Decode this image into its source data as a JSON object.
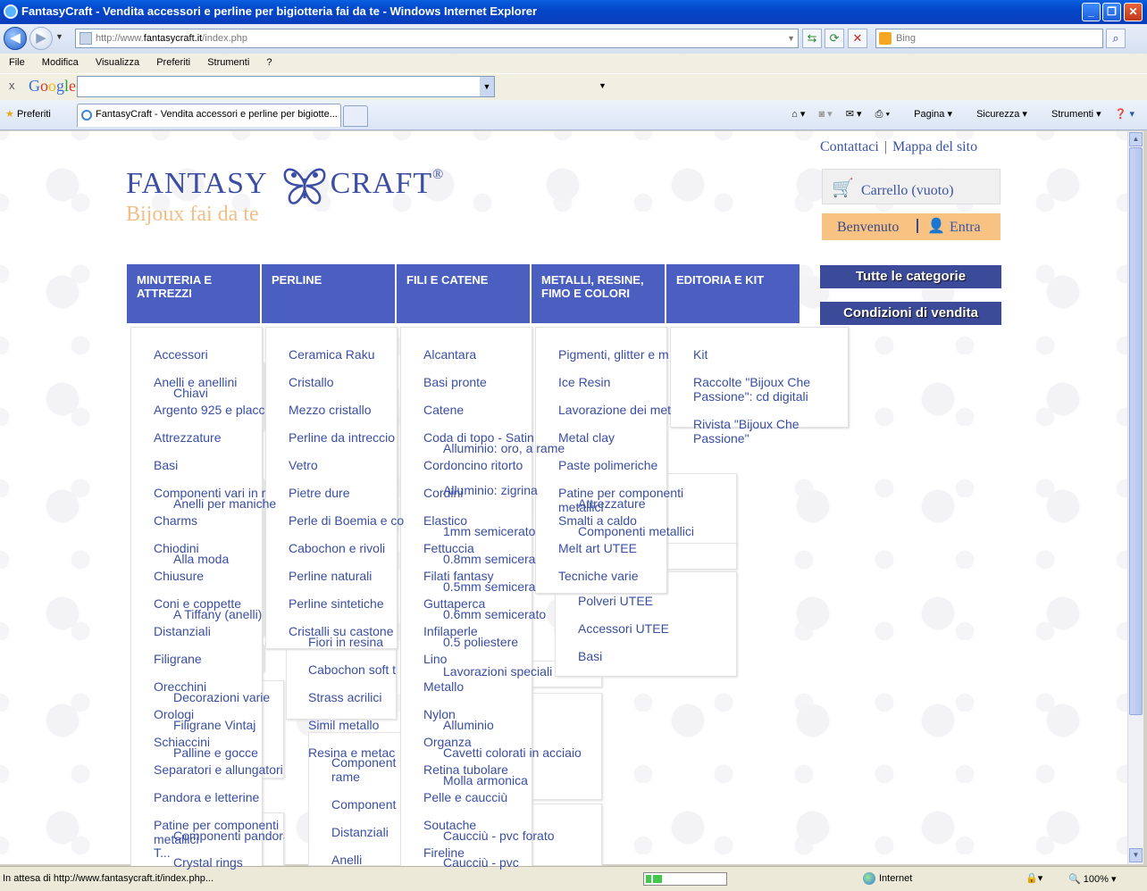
{
  "window": {
    "title": "FantasyCraft - Vendita accessori e perline per bigiotteria fai da te - Windows Internet Explorer"
  },
  "address": {
    "url_prefix": "http://www.",
    "url_domain": "fantasycraft.it",
    "url_path": "/index.php",
    "search_placeholder": "Bing"
  },
  "menu": [
    "File",
    "Modifica",
    "Visualizza",
    "Preferiti",
    "Strumenti",
    "?"
  ],
  "google": {
    "close": "x",
    "logo": "Google"
  },
  "tabs": {
    "favorites": "Preferiti",
    "active": "FantasyCraft - Vendita accessori e perline per bigiotte...",
    "commands": [
      "Pagina",
      "Sicurezza",
      "Strumenti"
    ]
  },
  "site": {
    "toplinks": [
      "Contattaci",
      "Mappa del sito"
    ],
    "logo_main": "FANTASY",
    "logo_main2": "CRAFT",
    "logo_reg": "®",
    "logo_tag": "Bijoux fai da te",
    "cart": "Carrello (vuoto)",
    "welcome": "Benvenuto",
    "login": "Entra",
    "side_buttons": [
      "Tutte le categorie",
      "Condizioni di vendita"
    ],
    "categories": [
      "MINUTERIA E ATTREZZI",
      "PERLINE",
      "FILI E CATENE",
      "METALLI, RESINE, FIMO E COLORI",
      "EDITORIA E KIT"
    ],
    "col1": [
      "Accessori",
      "Anelli e anellini",
      "Argento 925 e placc",
      "Attrezzature",
      "Basi",
      "Componenti vari in r",
      "Charms",
      "Chiodini",
      "Chiusure",
      "Coni e coppette",
      "Distanziali",
      "Filigrane",
      "Orecchini",
      "Orologi",
      "Schiaccini",
      "Separatori e allungatori",
      "Pandora e letterine",
      "Patine per componenti metallici",
      "T..."
    ],
    "col1_ghost": [
      "Chiavi",
      "Anelli per maniche",
      "Alla moda",
      "A Tiffany (anelli)",
      "Decorazioni varie",
      "Filigrane Vintaj",
      "Palline e gocce",
      "Componenti pandora",
      "Crystal rings"
    ],
    "col2": [
      "Ceramica Raku",
      "Cristallo",
      "Mezzo cristallo",
      "Perline da intreccio",
      "Vetro",
      "Pietre dure",
      "Perle di Boemia e co",
      "Cabochon e rivoli",
      "Perline naturali",
      "Perline sintetiche",
      "Cristalli su castone"
    ],
    "col2_ghost": [
      "Fiori in resina",
      "Cabochon soft t",
      "Strass acrilici",
      "Simil metallo",
      "Resina e metac",
      "Component rame",
      "Component",
      "Distanziali",
      "Anelli"
    ],
    "col3": [
      "Alcantara",
      "Basi pronte",
      "Catene",
      "Coda di topo - Satin",
      "Cordoncino ritorto",
      "Cordini",
      "Elastico",
      "Fettuccia",
      "Filati fantasy",
      "Guttaperca",
      "Infilaperle",
      "Lino",
      "Metallo",
      "Nylon",
      "Organza",
      "Retina tubolare",
      "Pelle e caucciù",
      "Soutache",
      "Fireline"
    ],
    "col3_ghost": [
      "Alluminio: oro, a rame",
      "Alluminio: zigrina",
      "1mm semicerato",
      "0.8mm semicera",
      "0.5mm semicera",
      "0.6mm semicerato",
      "0.5 poliestere",
      "Lavorazioni speciali",
      "Alluminio",
      "Cavetti colorati in acciaio",
      "Molla armonica",
      "Caucciù - pvc forato",
      "Caucciù - pvc"
    ],
    "col4": [
      "Pigmenti, glitter e m",
      "Ice Resin",
      "Lavorazione dei met",
      "Metal clay",
      "Paste polimeriche",
      "Patine per componenti metallici",
      "Smalti a caldo",
      "Melt art UTEE",
      "Tecniche varie"
    ],
    "col4_ghost": [
      "Attrezzature",
      "Componenti metallici",
      "Polveri UTEE",
      "Accessori UTEE",
      "Basi"
    ],
    "col5": [
      "Kit",
      "Raccolte \"Bijoux Che Passione\": cd digitali",
      "Rivista \"Bijoux Che Passione\""
    ]
  },
  "status": {
    "text": "In attesa di http://www.fantasycraft.it/index.php...",
    "progress": 0.2,
    "zone": "Internet",
    "zoom": "100%"
  }
}
